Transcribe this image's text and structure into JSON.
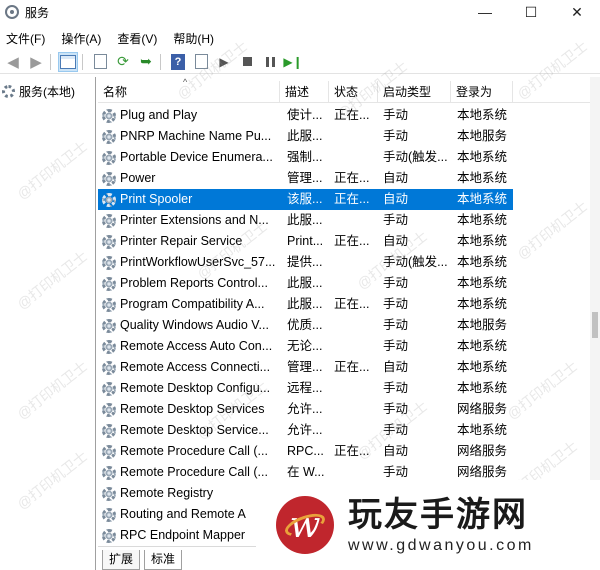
{
  "window": {
    "title": "服务",
    "minimize_glyph": "—",
    "maximize_glyph": "☐",
    "close_glyph": "✕"
  },
  "menu": [
    "文件(F)",
    "操作(A)",
    "查看(V)",
    "帮助(H)"
  ],
  "toolbar": {
    "icons": [
      "back-arrow-icon",
      "forward-arrow-icon",
      "console-tree-icon",
      "properties-icon",
      "refresh-icon",
      "export-icon",
      "help-icon",
      "show-hide-icon",
      "start-service-icon",
      "stop-service-icon",
      "pause-service-icon",
      "resume-service-icon"
    ]
  },
  "tree": {
    "root_label": "服务(本地)"
  },
  "table": {
    "headers": {
      "name": "名称",
      "description": "描述",
      "status": "状态",
      "startup_type": "启动类型",
      "logon_as": "登录为"
    },
    "sort_indicator": "^",
    "selected_index": 4,
    "rows": [
      {
        "name": "Plug and Play",
        "description": "使计...",
        "status": "正在...",
        "startup": "手动",
        "logon": "本地系统"
      },
      {
        "name": "PNRP Machine Name Pu...",
        "description": "此服...",
        "status": "",
        "startup": "手动",
        "logon": "本地服务"
      },
      {
        "name": "Portable Device Enumera...",
        "description": "强制...",
        "status": "",
        "startup": "手动(触发...",
        "logon": "本地系统"
      },
      {
        "name": "Power",
        "description": "管理...",
        "status": "正在...",
        "startup": "自动",
        "logon": "本地系统"
      },
      {
        "name": "Print Spooler",
        "description": "该服...",
        "status": "正在...",
        "startup": "自动",
        "logon": "本地系统"
      },
      {
        "name": "Printer Extensions and N...",
        "description": "此服...",
        "status": "",
        "startup": "手动",
        "logon": "本地系统"
      },
      {
        "name": "Printer Repair Service",
        "description": "Print...",
        "status": "正在...",
        "startup": "自动",
        "logon": "本地系统"
      },
      {
        "name": "PrintWorkflowUserSvc_57...",
        "description": "提供...",
        "status": "",
        "startup": "手动(触发...",
        "logon": "本地系统"
      },
      {
        "name": "Problem Reports Control...",
        "description": "此服...",
        "status": "",
        "startup": "手动",
        "logon": "本地系统"
      },
      {
        "name": "Program Compatibility A...",
        "description": "此服...",
        "status": "正在...",
        "startup": "手动",
        "logon": "本地系统"
      },
      {
        "name": "Quality Windows Audio V...",
        "description": "优质...",
        "status": "",
        "startup": "手动",
        "logon": "本地服务"
      },
      {
        "name": "Remote Access Auto Con...",
        "description": "无论...",
        "status": "",
        "startup": "手动",
        "logon": "本地系统"
      },
      {
        "name": "Remote Access Connecti...",
        "description": "管理...",
        "status": "正在...",
        "startup": "自动",
        "logon": "本地系统"
      },
      {
        "name": "Remote Desktop Configu...",
        "description": "远程...",
        "status": "",
        "startup": "手动",
        "logon": "本地系统"
      },
      {
        "name": "Remote Desktop Services",
        "description": "允许...",
        "status": "",
        "startup": "手动",
        "logon": "网络服务"
      },
      {
        "name": "Remote Desktop Service...",
        "description": "允许...",
        "status": "",
        "startup": "手动",
        "logon": "本地系统"
      },
      {
        "name": "Remote Procedure Call (...",
        "description": "RPC...",
        "status": "正在...",
        "startup": "自动",
        "logon": "网络服务"
      },
      {
        "name": "Remote Procedure Call (...",
        "description": "在 W...",
        "status": "",
        "startup": "手动",
        "logon": "网络服务"
      },
      {
        "name": "Remote Registry",
        "description": "",
        "status": "",
        "startup": "",
        "logon": ""
      },
      {
        "name": "Routing and Remote A",
        "description": "",
        "status": "",
        "startup": "",
        "logon": ""
      },
      {
        "name": "RPC Endpoint Mapper",
        "description": "",
        "status": "",
        "startup": "",
        "logon": ""
      }
    ]
  },
  "tabs": [
    "扩展",
    "标准"
  ],
  "active_tab": "标准",
  "watermark_text": "@打印机卫士",
  "ad": {
    "name": "玩友手游网",
    "url": "www.gdwanyou.com",
    "brand_color": "#c0262d"
  },
  "colors": {
    "selection": "#0078d7"
  }
}
